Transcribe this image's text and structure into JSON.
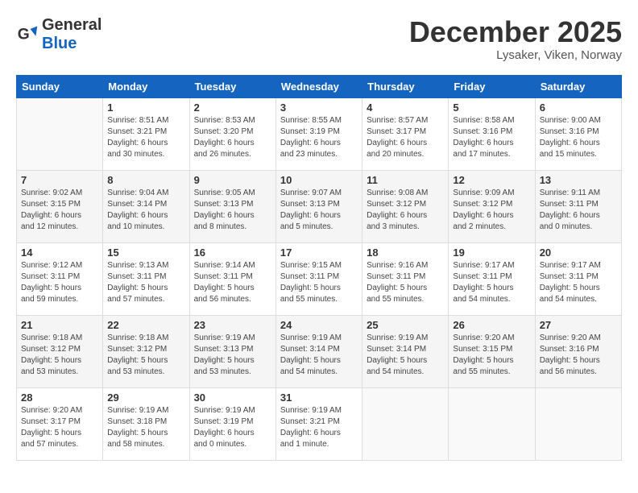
{
  "header": {
    "logo_general": "General",
    "logo_blue": "Blue",
    "month_title": "December 2025",
    "location": "Lysaker, Viken, Norway"
  },
  "days_of_week": [
    "Sunday",
    "Monday",
    "Tuesday",
    "Wednesday",
    "Thursday",
    "Friday",
    "Saturday"
  ],
  "weeks": [
    [
      {
        "day": "",
        "info": ""
      },
      {
        "day": "1",
        "info": "Sunrise: 8:51 AM\nSunset: 3:21 PM\nDaylight: 6 hours\nand 30 minutes."
      },
      {
        "day": "2",
        "info": "Sunrise: 8:53 AM\nSunset: 3:20 PM\nDaylight: 6 hours\nand 26 minutes."
      },
      {
        "day": "3",
        "info": "Sunrise: 8:55 AM\nSunset: 3:19 PM\nDaylight: 6 hours\nand 23 minutes."
      },
      {
        "day": "4",
        "info": "Sunrise: 8:57 AM\nSunset: 3:17 PM\nDaylight: 6 hours\nand 20 minutes."
      },
      {
        "day": "5",
        "info": "Sunrise: 8:58 AM\nSunset: 3:16 PM\nDaylight: 6 hours\nand 17 minutes."
      },
      {
        "day": "6",
        "info": "Sunrise: 9:00 AM\nSunset: 3:16 PM\nDaylight: 6 hours\nand 15 minutes."
      }
    ],
    [
      {
        "day": "7",
        "info": "Sunrise: 9:02 AM\nSunset: 3:15 PM\nDaylight: 6 hours\nand 12 minutes."
      },
      {
        "day": "8",
        "info": "Sunrise: 9:04 AM\nSunset: 3:14 PM\nDaylight: 6 hours\nand 10 minutes."
      },
      {
        "day": "9",
        "info": "Sunrise: 9:05 AM\nSunset: 3:13 PM\nDaylight: 6 hours\nand 8 minutes."
      },
      {
        "day": "10",
        "info": "Sunrise: 9:07 AM\nSunset: 3:13 PM\nDaylight: 6 hours\nand 5 minutes."
      },
      {
        "day": "11",
        "info": "Sunrise: 9:08 AM\nSunset: 3:12 PM\nDaylight: 6 hours\nand 3 minutes."
      },
      {
        "day": "12",
        "info": "Sunrise: 9:09 AM\nSunset: 3:12 PM\nDaylight: 6 hours\nand 2 minutes."
      },
      {
        "day": "13",
        "info": "Sunrise: 9:11 AM\nSunset: 3:11 PM\nDaylight: 6 hours\nand 0 minutes."
      }
    ],
    [
      {
        "day": "14",
        "info": "Sunrise: 9:12 AM\nSunset: 3:11 PM\nDaylight: 5 hours\nand 59 minutes."
      },
      {
        "day": "15",
        "info": "Sunrise: 9:13 AM\nSunset: 3:11 PM\nDaylight: 5 hours\nand 57 minutes."
      },
      {
        "day": "16",
        "info": "Sunrise: 9:14 AM\nSunset: 3:11 PM\nDaylight: 5 hours\nand 56 minutes."
      },
      {
        "day": "17",
        "info": "Sunrise: 9:15 AM\nSunset: 3:11 PM\nDaylight: 5 hours\nand 55 minutes."
      },
      {
        "day": "18",
        "info": "Sunrise: 9:16 AM\nSunset: 3:11 PM\nDaylight: 5 hours\nand 55 minutes."
      },
      {
        "day": "19",
        "info": "Sunrise: 9:17 AM\nSunset: 3:11 PM\nDaylight: 5 hours\nand 54 minutes."
      },
      {
        "day": "20",
        "info": "Sunrise: 9:17 AM\nSunset: 3:11 PM\nDaylight: 5 hours\nand 54 minutes."
      }
    ],
    [
      {
        "day": "21",
        "info": "Sunrise: 9:18 AM\nSunset: 3:12 PM\nDaylight: 5 hours\nand 53 minutes."
      },
      {
        "day": "22",
        "info": "Sunrise: 9:18 AM\nSunset: 3:12 PM\nDaylight: 5 hours\nand 53 minutes."
      },
      {
        "day": "23",
        "info": "Sunrise: 9:19 AM\nSunset: 3:13 PM\nDaylight: 5 hours\nand 53 minutes."
      },
      {
        "day": "24",
        "info": "Sunrise: 9:19 AM\nSunset: 3:14 PM\nDaylight: 5 hours\nand 54 minutes."
      },
      {
        "day": "25",
        "info": "Sunrise: 9:19 AM\nSunset: 3:14 PM\nDaylight: 5 hours\nand 54 minutes."
      },
      {
        "day": "26",
        "info": "Sunrise: 9:20 AM\nSunset: 3:15 PM\nDaylight: 5 hours\nand 55 minutes."
      },
      {
        "day": "27",
        "info": "Sunrise: 9:20 AM\nSunset: 3:16 PM\nDaylight: 5 hours\nand 56 minutes."
      }
    ],
    [
      {
        "day": "28",
        "info": "Sunrise: 9:20 AM\nSunset: 3:17 PM\nDaylight: 5 hours\nand 57 minutes."
      },
      {
        "day": "29",
        "info": "Sunrise: 9:19 AM\nSunset: 3:18 PM\nDaylight: 5 hours\nand 58 minutes."
      },
      {
        "day": "30",
        "info": "Sunrise: 9:19 AM\nSunset: 3:19 PM\nDaylight: 6 hours\nand 0 minutes."
      },
      {
        "day": "31",
        "info": "Sunrise: 9:19 AM\nSunset: 3:21 PM\nDaylight: 6 hours\nand 1 minute."
      },
      {
        "day": "",
        "info": ""
      },
      {
        "day": "",
        "info": ""
      },
      {
        "day": "",
        "info": ""
      }
    ]
  ]
}
